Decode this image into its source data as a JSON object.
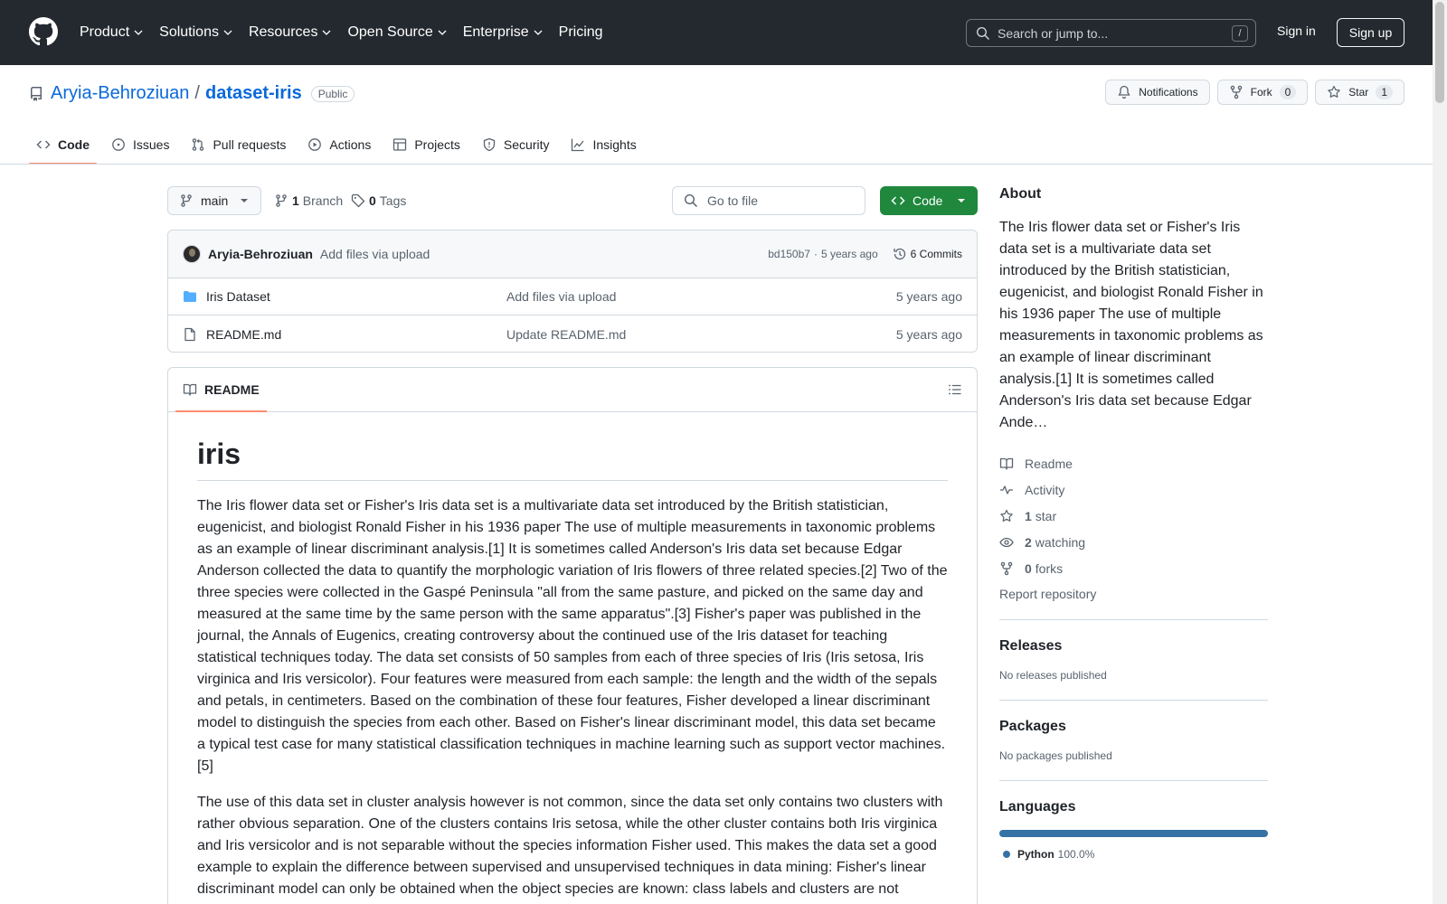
{
  "header": {
    "nav": [
      {
        "label": "Product",
        "has_menu": true
      },
      {
        "label": "Solutions",
        "has_menu": true
      },
      {
        "label": "Resources",
        "has_menu": true
      },
      {
        "label": "Open Source",
        "has_menu": true
      },
      {
        "label": "Enterprise",
        "has_menu": true
      },
      {
        "label": "Pricing",
        "has_menu": false
      }
    ],
    "search_placeholder": "Search or jump to...",
    "search_shortcut": "/",
    "sign_in": "Sign in",
    "sign_up": "Sign up"
  },
  "repo": {
    "owner": "Aryia-Behroziuan",
    "separator": "/",
    "name": "dataset-iris",
    "visibility": "Public",
    "notifications_label": "Notifications",
    "fork_label": "Fork",
    "fork_count": "0",
    "star_label": "Star",
    "star_count": "1"
  },
  "tabs": [
    {
      "label": "Code",
      "icon": "code-icon",
      "active": true
    },
    {
      "label": "Issues",
      "icon": "issue-icon",
      "active": false
    },
    {
      "label": "Pull requests",
      "icon": "pull-request-icon",
      "active": false
    },
    {
      "label": "Actions",
      "icon": "play-icon",
      "active": false
    },
    {
      "label": "Projects",
      "icon": "table-icon",
      "active": false
    },
    {
      "label": "Security",
      "icon": "shield-icon",
      "active": false
    },
    {
      "label": "Insights",
      "icon": "graph-icon",
      "active": false
    }
  ],
  "toolbar": {
    "branch": "main",
    "branch_count": "1",
    "branch_label": "Branch",
    "tag_count": "0",
    "tag_label": "Tags",
    "goto_placeholder": "Go to file",
    "code_label": "Code"
  },
  "latest_commit": {
    "author": "Aryia-Behroziuan",
    "message": "Add files via upload",
    "hash": "bd150b7",
    "dot": "·",
    "time": "5 years ago",
    "commits": "6 Commits"
  },
  "files": [
    {
      "name": "Iris Dataset",
      "type": "folder",
      "message": "Add files via upload",
      "date": "5 years ago"
    },
    {
      "name": "README.md",
      "type": "file",
      "message": "Update README.md",
      "date": "5 years ago"
    }
  ],
  "readme": {
    "tab_label": "README",
    "title": "iris",
    "paragraphs": [
      "The Iris flower data set or Fisher's Iris data set is a multivariate data set introduced by the British statistician, eugenicist, and biologist Ronald Fisher in his 1936 paper The use of multiple measurements in taxonomic problems as an example of linear discriminant analysis.[1] It is sometimes called Anderson's Iris data set because Edgar Anderson collected the data to quantify the morphologic variation of Iris flowers of three related species.[2] Two of the three species were collected in the Gaspé Peninsula \"all from the same pasture, and picked on the same day and measured at the same time by the same person with the same apparatus\".[3] Fisher's paper was published in the journal, the Annals of Eugenics, creating controversy about the continued use of the Iris dataset for teaching statistical techniques today. The data set consists of 50 samples from each of three species of Iris (Iris setosa, Iris virginica and Iris versicolor). Four features were measured from each sample: the length and the width of the sepals and petals, in centimeters. Based on the combination of these four features, Fisher developed a linear discriminant model to distinguish the species from each other. Based on Fisher's linear discriminant model, this data set became a typical test case for many statistical classification techniques in machine learning such as support vector machines.[5]",
      "The use of this data set in cluster analysis however is not common, since the data set only contains two clusters with rather obvious separation. One of the clusters contains Iris setosa, while the other cluster contains both Iris virginica and Iris versicolor and is not separable without the species information Fisher used. This makes the data set a good example to explain the difference between supervised and unsupervised techniques in data mining: Fisher's linear discriminant model can only be obtained when the object species are known: class labels and clusters are not"
    ]
  },
  "about": {
    "heading": "About",
    "description": "The Iris flower data set or Fisher's Iris data set is a multivariate data set introduced by the British statistician, eugenicist, and biologist Ronald Fisher in his 1936 paper The use of multiple measurements in taxonomic problems as an example of linear discriminant analysis.[1] It is sometimes called Anderson's Iris data set because Edgar Ande…",
    "readme": "Readme",
    "activity": "Activity",
    "stars_count": "1",
    "stars_label": "star",
    "watching_count": "2",
    "watching_label": "watching",
    "forks_count": "0",
    "forks_label": "forks",
    "report": "Report repository"
  },
  "releases": {
    "heading": "Releases",
    "empty": "No releases published"
  },
  "packages": {
    "heading": "Packages",
    "empty": "No packages published"
  },
  "languages": {
    "heading": "Languages",
    "items": [
      {
        "name": "Python",
        "percent": "100.0%",
        "color": "#3572a5"
      }
    ]
  },
  "colors": {
    "header_bg": "#24292f",
    "link": "#0969da",
    "primary_button": "#1f883d",
    "tab_underline": "#fd8c73"
  }
}
